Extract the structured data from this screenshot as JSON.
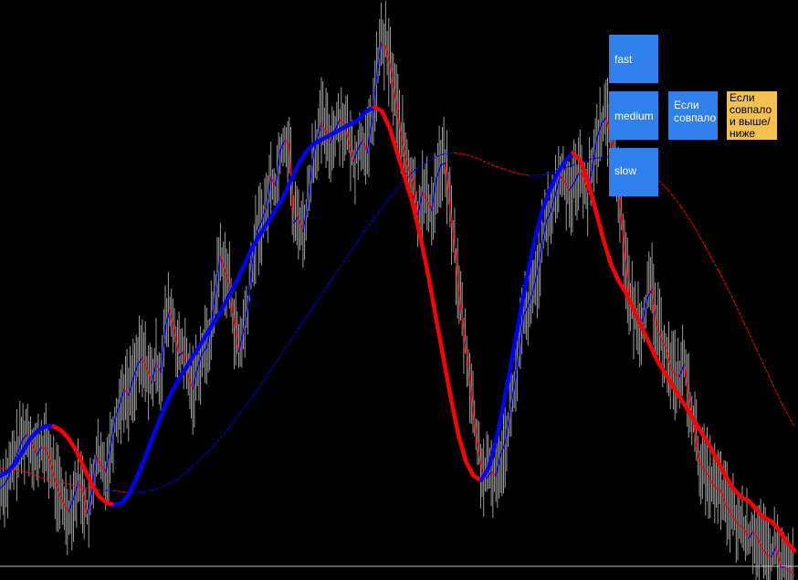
{
  "buttons": {
    "fast": "fast",
    "medium": "medium",
    "slow": "slow",
    "cross": "Если совпало",
    "cross_dir": "Если совпало и выше/ниже"
  },
  "colors": {
    "background": "#000000",
    "bull": "#0000ff",
    "bear": "#ff0000",
    "price": "#cfcfcf",
    "button": "#2f80ed",
    "button_alt": "#f2c14e"
  },
  "chart_data": {
    "type": "line",
    "series": [
      {
        "values": [
          0.42,
          0.44,
          0.48,
          0.55,
          0.6,
          0.66,
          0.68,
          0.64,
          0.58,
          0.62,
          0.61,
          0.55,
          0.46,
          0.39,
          0.34,
          0.31,
          0.37,
          0.45,
          0.41,
          0.3,
          0.4,
          0.58,
          0.53,
          0.5,
          0.61,
          0.75,
          0.82,
          0.9,
          0.87,
          0.95,
          1.02,
          1.05,
          1.0,
          0.93,
          1.02,
          0.98,
          1.2,
          1.28,
          1.18,
          1.06,
          1.08,
          0.96,
          0.9,
          1.0,
          1.07,
          1.1,
          1.2,
          1.38,
          1.54,
          1.47,
          1.4,
          1.22,
          1.08,
          1.18,
          1.3,
          1.52,
          1.66,
          1.71,
          1.78,
          1.92,
          1.88,
          2.05,
          2.1,
          2.08,
          1.7,
          1.73,
          1.66,
          1.79,
          2.0,
          2.1,
          2.18,
          2.14,
          2.09,
          2.15,
          2.2,
          2.18,
          2.09,
          2.0,
          2.06,
          2.1,
          2.04,
          2.19,
          2.4,
          2.57,
          2.55,
          2.46,
          2.32,
          2.17,
          2.05,
          1.96,
          1.9,
          1.74,
          1.85,
          1.81,
          1.76,
          1.91,
          1.98,
          1.99,
          1.78,
          1.58,
          1.36,
          1.17,
          1.02,
          0.8,
          0.63,
          0.5,
          0.47,
          0.5,
          0.48,
          0.58,
          0.64,
          0.78,
          0.91,
          1.08,
          1.25,
          1.3,
          1.36,
          1.46,
          1.59,
          1.71,
          1.76,
          1.84,
          1.93,
          1.9,
          1.86,
          1.89,
          1.94,
          1.93,
          1.85,
          1.97,
          2.11,
          2.18,
          2.21,
          2.12,
          2.0,
          1.79,
          1.58,
          1.35,
          1.26,
          1.23,
          1.23,
          1.34,
          1.38,
          1.21,
          1.14,
          1.1,
          1.01,
          0.97,
          0.96,
          1.02,
          0.86,
          0.75,
          0.57,
          0.52,
          0.49,
          0.45,
          0.42,
          0.41,
          0.34,
          0.31,
          0.27,
          0.24,
          0.23,
          0.18,
          0.21,
          0.18,
          0.13,
          0.1,
          0.09,
          0.14,
          0.04,
          0.04,
          0.02,
          0.0
        ]
      },
      {
        "values": [
          0.48,
          0.5,
          0.54,
          0.6,
          0.66,
          0.7,
          0.72,
          0.72,
          0.7,
          0.66,
          0.6,
          0.52,
          0.44,
          0.38,
          0.35,
          0.34,
          0.35,
          0.4,
          0.48,
          0.57,
          0.67,
          0.76,
          0.85,
          0.92,
          0.98,
          1.04,
          1.1,
          1.16,
          1.22,
          1.28,
          1.35,
          1.42,
          1.5,
          1.58,
          1.64,
          1.7,
          1.76,
          1.82,
          1.9,
          1.98,
          2.04,
          2.08,
          2.1,
          2.12,
          2.14,
          2.16,
          2.18,
          2.2,
          2.24,
          2.26,
          2.24,
          2.16,
          2.04,
          1.92,
          1.8,
          1.64,
          1.46,
          1.26,
          1.06,
          0.86,
          0.68,
          0.55,
          0.48,
          0.46,
          0.52,
          0.66,
          0.84,
          1.04,
          1.24,
          1.44,
          1.62,
          1.76,
          1.86,
          1.94,
          2.0,
          2.04,
          2.0,
          1.9,
          1.76,
          1.62,
          1.5,
          1.42,
          1.36,
          1.28,
          1.2,
          1.12,
          1.04,
          0.98,
          0.92,
          0.86,
          0.8,
          0.74,
          0.68,
          0.62,
          0.55,
          0.48,
          0.42,
          0.38,
          0.36,
          0.32,
          0.28,
          0.26,
          0.22,
          0.16,
          0.12
        ]
      },
      {
        "values": [
          0.52,
          0.51,
          0.5,
          0.48,
          0.46,
          0.45,
          0.43,
          0.42,
          0.41,
          0.41,
          0.4,
          0.4,
          0.41,
          0.43,
          0.46,
          0.51,
          0.57,
          0.63,
          0.7,
          0.78,
          0.86,
          0.95,
          1.04,
          1.13,
          1.22,
          1.31,
          1.4,
          1.49,
          1.58,
          1.67,
          1.75,
          1.83,
          1.9,
          1.96,
          2.0,
          2.03,
          2.04,
          2.03,
          2.01,
          1.98,
          1.96,
          1.94,
          1.93,
          1.93,
          1.95,
          1.97,
          1.99,
          2.01,
          2.02,
          2.02,
          2.0,
          1.97,
          1.92,
          1.86,
          1.78,
          1.69,
          1.58,
          1.47,
          1.35,
          1.22,
          1.09,
          0.96,
          0.83,
          0.72
        ]
      }
    ]
  }
}
